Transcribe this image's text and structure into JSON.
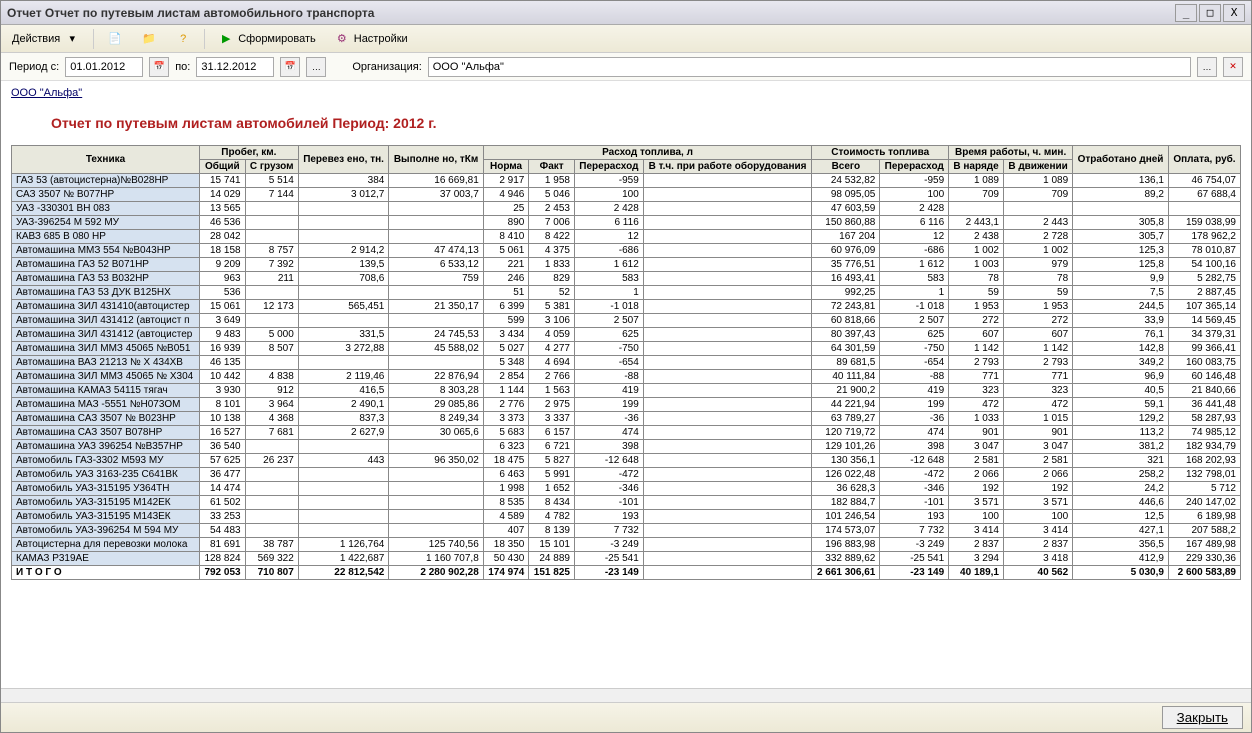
{
  "window": {
    "title": "Отчет  Отчет по путевым листам автомобильного транспорта"
  },
  "toolbar": {
    "actions": "Действия",
    "form": "Сформировать",
    "settings": "Настройки"
  },
  "period": {
    "label_from": "Период с:",
    "date_from": "01.01.2012",
    "label_to": "по:",
    "date_to": "31.12.2012",
    "org_label": "Организация:",
    "org_value": "ООО \"Альфа\""
  },
  "company_link": "ООО \"Альфа\"",
  "report_title": "Отчет по путевым листам автомобилей  Период: 2012 г.",
  "headers": {
    "tech": "Техника",
    "mileage": "Пробег, км.",
    "mileage_total": "Общий",
    "mileage_cargo": "С грузом",
    "transported": "Перевез ено, тн.",
    "done": "Выполне но, тКм",
    "fuel": "Расход топлива, л",
    "fuel_norm": "Норма",
    "fuel_fact": "Факт",
    "fuel_over": "Перерасход",
    "fuel_equip": "В т.ч. при работе оборудования",
    "cost": "Стоимость топлива",
    "cost_total": "Всего",
    "cost_over": "Перерасход",
    "worktime": "Время работы, ч. мин.",
    "worktime_duty": "В наряде",
    "worktime_move": "В движении",
    "days": "Отработано дней",
    "payment": "Оплата, руб."
  },
  "rows": [
    {
      "n": "ГАЗ 53 (автоцистерна)№В028НР",
      "m1": "15 741",
      "m2": "5 514",
      "tr": "384",
      "dn": "16 669,81",
      "fn": "2 917",
      "ff": "1 958",
      "fo": "-959",
      "fe": "",
      "ct": "24 532,82",
      "co": "-959",
      "wd": "1 089",
      "wm": "1 089",
      "dy": "136,1",
      "pa": "46 754,07"
    },
    {
      "n": "САЗ 3507  № В077НР",
      "m1": "14 029",
      "m2": "7 144",
      "tr": "3 012,7",
      "dn": "37 003,7",
      "fn": "4 946",
      "ff": "5 046",
      "fo": "100",
      "fe": "",
      "ct": "98 095,05",
      "co": "100",
      "wd": "709",
      "wm": "709",
      "dy": "89,2",
      "pa": "67 688,4"
    },
    {
      "n": "УАЗ -330301 ВН 083",
      "m1": "13 565",
      "m2": "",
      "tr": "",
      "dn": "",
      "fn": "25",
      "ff": "2 453",
      "fo": "2 428",
      "fe": "",
      "ct": "47 603,59",
      "co": "2 428",
      "wd": "",
      "wm": "",
      "dy": "",
      "pa": ""
    },
    {
      "n": "УАЗ-396254  М 592 МУ",
      "m1": "46 536",
      "m2": "",
      "tr": "",
      "dn": "",
      "fn": "890",
      "ff": "7 006",
      "fo": "6 116",
      "fe": "",
      "ct": "150 860,88",
      "co": "6 116",
      "wd": "2 443,1",
      "wm": "2 443",
      "dy": "305,8",
      "pa": "159 038,99"
    },
    {
      "n": "КАВЗ 685  В 080 НР",
      "m1": "28 042",
      "m2": "",
      "tr": "",
      "dn": "",
      "fn": "8 410",
      "ff": "8 422",
      "fo": "12",
      "fe": "",
      "ct": "167 204",
      "co": "12",
      "wd": "2 438",
      "wm": "2 728",
      "dy": "305,7",
      "pa": "178 962,2"
    },
    {
      "n": "Автомашина   ММЗ 554  №В043НР",
      "m1": "18 158",
      "m2": "8 757",
      "tr": "2 914,2",
      "dn": "47 474,13",
      "fn": "5 061",
      "ff": "4 375",
      "fo": "-686",
      "fe": "",
      "ct": "60 976,09",
      "co": "-686",
      "wd": "1 002",
      "wm": "1 002",
      "dy": "125,3",
      "pa": "78 010,87"
    },
    {
      "n": "Автомашина  ГАЗ 52  В071НР",
      "m1": "9 209",
      "m2": "7 392",
      "tr": "139,5",
      "dn": "6 533,12",
      "fn": "221",
      "ff": "1 833",
      "fo": "1 612",
      "fe": "",
      "ct": "35 776,51",
      "co": "1 612",
      "wd": "1 003",
      "wm": "979",
      "dy": "125,8",
      "pa": "54 100,16"
    },
    {
      "n": "Автомашина  ГАЗ 53  В032НР",
      "m1": "963",
      "m2": "211",
      "tr": "708,6",
      "dn": "759",
      "fn": "246",
      "ff": "829",
      "fo": "583",
      "fe": "",
      "ct": "16 493,41",
      "co": "583",
      "wd": "78",
      "wm": "78",
      "dy": "9,9",
      "pa": "5 282,75"
    },
    {
      "n": "Автомашина  ГАЗ 53  ДУК  В125НХ",
      "m1": "536",
      "m2": "",
      "tr": "",
      "dn": "",
      "fn": "51",
      "ff": "52",
      "fo": "1",
      "fe": "",
      "ct": "992,25",
      "co": "1",
      "wd": "59",
      "wm": "59",
      "dy": "7,5",
      "pa": "2 887,45"
    },
    {
      "n": "Автомашина  ЗИЛ 431410(автоцистер",
      "m1": "15 061",
      "m2": "12 173",
      "tr": "565,451",
      "dn": "21 350,17",
      "fn": "6 399",
      "ff": "5 381",
      "fo": "-1 018",
      "fe": "",
      "ct": "72 243,81",
      "co": "-1 018",
      "wd": "1 953",
      "wm": "1 953",
      "dy": "244,5",
      "pa": "107 365,14"
    },
    {
      "n": "Автомашина  ЗИЛ 431412 (автоцист п",
      "m1": "3 649",
      "m2": "",
      "tr": "",
      "dn": "",
      "fn": "599",
      "ff": "3 106",
      "fo": "2 507",
      "fe": "",
      "ct": "60 818,66",
      "co": "2 507",
      "wd": "272",
      "wm": "272",
      "dy": "33,9",
      "pa": "14 569,45"
    },
    {
      "n": "Автомашина  ЗИЛ 431412 (автоцистер",
      "m1": "9 483",
      "m2": "5 000",
      "tr": "331,5",
      "dn": "24 745,53",
      "fn": "3 434",
      "ff": "4 059",
      "fo": "625",
      "fe": "",
      "ct": "80 397,43",
      "co": "625",
      "wd": "607",
      "wm": "607",
      "dy": "76,1",
      "pa": "34 379,31"
    },
    {
      "n": "Автомашина  ЗИЛ ММЗ 45065 №В051",
      "m1": "16 939",
      "m2": "8 507",
      "tr": "3 272,88",
      "dn": "45 588,02",
      "fn": "5 027",
      "ff": "4 277",
      "fo": "-750",
      "fe": "",
      "ct": "64 301,59",
      "co": "-750",
      "wd": "1 142",
      "wm": "1 142",
      "dy": "142,8",
      "pa": "99 366,41"
    },
    {
      "n": "Автомашина ВАЗ 21213 № Х 434ХВ",
      "m1": "46 135",
      "m2": "",
      "tr": "",
      "dn": "",
      "fn": "5 348",
      "ff": "4 694",
      "fo": "-654",
      "fe": "",
      "ct": "89 681,5",
      "co": "-654",
      "wd": "2 793",
      "wm": "2 793",
      "dy": "349,2",
      "pa": "160 083,75"
    },
    {
      "n": "Автомашина ЗИЛ ММЗ 45065  № Х304",
      "m1": "10 442",
      "m2": "4 838",
      "tr": "2 119,46",
      "dn": "22 876,94",
      "fn": "2 854",
      "ff": "2 766",
      "fo": "-88",
      "fe": "",
      "ct": "40 111,84",
      "co": "-88",
      "wd": "771",
      "wm": "771",
      "dy": "96,9",
      "pa": "60 146,48"
    },
    {
      "n": "Автомашина КАМАЗ 54115 тягач",
      "m1": "3 930",
      "m2": "912",
      "tr": "416,5",
      "dn": "8 303,28",
      "fn": "1 144",
      "ff": "1 563",
      "fo": "419",
      "fe": "",
      "ct": "21 900,2",
      "co": "419",
      "wd": "323",
      "wm": "323",
      "dy": "40,5",
      "pa": "21 840,66"
    },
    {
      "n": "Автомашина МАЗ -5551  №Н073ОМ",
      "m1": "8 101",
      "m2": "3 964",
      "tr": "2 490,1",
      "dn": "29 085,86",
      "fn": "2 776",
      "ff": "2 975",
      "fo": "199",
      "fe": "",
      "ct": "44 221,94",
      "co": "199",
      "wd": "472",
      "wm": "472",
      "dy": "59,1",
      "pa": "36 441,48"
    },
    {
      "n": "Автомашина САЗ 3507 № В023НР",
      "m1": "10 138",
      "m2": "4 368",
      "tr": "837,3",
      "dn": "8 249,34",
      "fn": "3 373",
      "ff": "3 337",
      "fo": "-36",
      "fe": "",
      "ct": "63 789,27",
      "co": "-36",
      "wd": "1 033",
      "wm": "1 015",
      "dy": "129,2",
      "pa": "58 287,93"
    },
    {
      "n": "Автомашина САЗ 3507 В078НР",
      "m1": "16 527",
      "m2": "7 681",
      "tr": "2 627,9",
      "dn": "30 065,6",
      "fn": "5 683",
      "ff": "6 157",
      "fo": "474",
      "fe": "",
      "ct": "120 719,72",
      "co": "474",
      "wd": "901",
      "wm": "901",
      "dy": "113,2",
      "pa": "74 985,12"
    },
    {
      "n": "Автомашина УАЗ 396254 №В357НР",
      "m1": "36 540",
      "m2": "",
      "tr": "",
      "dn": "",
      "fn": "6 323",
      "ff": "6 721",
      "fo": "398",
      "fe": "",
      "ct": "129 101,26",
      "co": "398",
      "wd": "3 047",
      "wm": "3 047",
      "dy": "381,2",
      "pa": "182 934,79"
    },
    {
      "n": "Автомобиль ГАЗ-3302  М593 МУ",
      "m1": "57 625",
      "m2": "26 237",
      "tr": "443",
      "dn": "96 350,02",
      "fn": "18 475",
      "ff": "5 827",
      "fo": "-12 648",
      "fe": "",
      "ct": "130 356,1",
      "co": "-12 648",
      "wd": "2 581",
      "wm": "2 581",
      "dy": "321",
      "pa": "168 202,93"
    },
    {
      "n": "Автомобиль УАЗ 3163-235 С641ВК",
      "m1": "36 477",
      "m2": "",
      "tr": "",
      "dn": "",
      "fn": "6 463",
      "ff": "5 991",
      "fo": "-472",
      "fe": "",
      "ct": "126 022,48",
      "co": "-472",
      "wd": "2 066",
      "wm": "2 066",
      "dy": "258,2",
      "pa": "132 798,01"
    },
    {
      "n": "Автомобиль УАЗ-315195  У364ТН",
      "m1": "14 474",
      "m2": "",
      "tr": "",
      "dn": "",
      "fn": "1 998",
      "ff": "1 652",
      "fo": "-346",
      "fe": "",
      "ct": "36 628,3",
      "co": "-346",
      "wd": "192",
      "wm": "192",
      "dy": "24,2",
      "pa": "5 712"
    },
    {
      "n": "Автомобиль УАЗ-315195 М142ЕК",
      "m1": "61 502",
      "m2": "",
      "tr": "",
      "dn": "",
      "fn": "8 535",
      "ff": "8 434",
      "fo": "-101",
      "fe": "",
      "ct": "182 884,7",
      "co": "-101",
      "wd": "3 571",
      "wm": "3 571",
      "dy": "446,6",
      "pa": "240 147,02"
    },
    {
      "n": "Автомобиль УАЗ-315195 М143ЕК",
      "m1": "33 253",
      "m2": "",
      "tr": "",
      "dn": "",
      "fn": "4 589",
      "ff": "4 782",
      "fo": "193",
      "fe": "",
      "ct": "101 246,54",
      "co": "193",
      "wd": "100",
      "wm": "100",
      "dy": "12,5",
      "pa": "6 189,98"
    },
    {
      "n": "Автомобиль УАЗ-396254  М 594 МУ",
      "m1": "54 483",
      "m2": "",
      "tr": "",
      "dn": "",
      "fn": "407",
      "ff": "8 139",
      "fo": "7 732",
      "fe": "",
      "ct": "174 573,07",
      "co": "7 732",
      "wd": "3 414",
      "wm": "3 414",
      "dy": "427,1",
      "pa": "207 588,2"
    },
    {
      "n": "Автоцистерна для перевозки  молока",
      "m1": "81 691",
      "m2": "38 787",
      "tr": "1 126,764",
      "dn": "125 740,56",
      "fn": "18 350",
      "ff": "15 101",
      "fo": "-3 249",
      "fe": "",
      "ct": "196 883,98",
      "co": "-3 249",
      "wd": "2 837",
      "wm": "2 837",
      "dy": "356,5",
      "pa": "167 489,98"
    },
    {
      "n": "КАМАЗ  Р319АЕ",
      "m1": "128 824",
      "m2": "569 322",
      "tr": "1 422,687",
      "dn": "1 160 707,8",
      "fn": "50 430",
      "ff": "24 889",
      "fo": "-25 541",
      "fe": "",
      "ct": "332 889,62",
      "co": "-25 541",
      "wd": "3 294",
      "wm": "3 418",
      "dy": "412,9",
      "pa": "229 330,36"
    }
  ],
  "total": {
    "n": "И Т О Г О",
    "m1": "792 053",
    "m2": "710 807",
    "tr": "22 812,542",
    "dn": "2 280 902,28",
    "fn": "174 974",
    "ff": "151 825",
    "fo": "-23 149",
    "fe": "",
    "ct": "2 661 306,61",
    "co": "-23 149",
    "wd": "40 189,1",
    "wm": "40 562",
    "dy": "5 030,9",
    "pa": "2 600 583,89"
  },
  "footer": {
    "close": "Закрыть"
  }
}
